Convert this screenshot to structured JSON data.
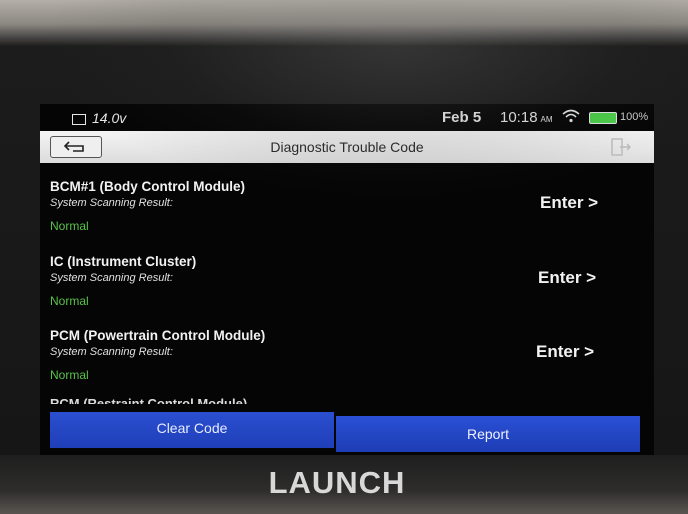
{
  "status_bar": {
    "voltage": "14.0v",
    "date": "Feb 5",
    "time": "10:18",
    "ampm": "AM",
    "battery": "100%"
  },
  "header": {
    "title": "Diagnostic Trouble Code"
  },
  "modules": [
    {
      "name": "BCM#1 (Body Control Module)",
      "result_label": "System Scanning Result:",
      "result": "Normal",
      "action": "Enter >"
    },
    {
      "name": "IC (Instrument Cluster)",
      "result_label": "System Scanning Result:",
      "result": "Normal",
      "action": "Enter >"
    },
    {
      "name": "PCM (Powertrain Control Module)",
      "result_label": "System Scanning Result:",
      "result": "Normal",
      "action": "Enter >"
    }
  ],
  "partial_module": "RCM (Restraint Control Module)",
  "buttons": {
    "clear": "Clear Code",
    "report": "Report"
  },
  "device_brand": "LAUNCH",
  "colors": {
    "normal_status": "#58c24a",
    "button_blue": "#2348c8",
    "battery": "#4cd04a"
  }
}
